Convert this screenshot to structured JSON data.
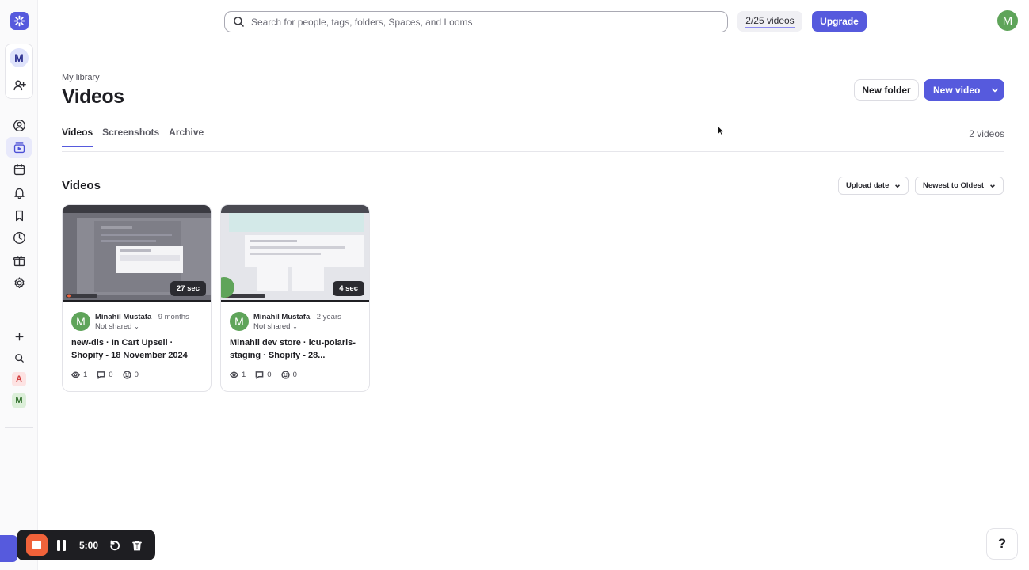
{
  "workspace": {
    "avatar_letter": "M"
  },
  "search": {
    "placeholder": "Search for people, tags, folders, Spaces, and Looms"
  },
  "topbar": {
    "quota": "2/25 videos",
    "upgrade_label": "Upgrade",
    "user_initial": "M"
  },
  "spaces": [
    {
      "letter": "A",
      "bg": "#fde3e3",
      "color": "#d13b3b"
    },
    {
      "letter": "M",
      "bg": "#dcefd9",
      "color": "#2f6e2a"
    }
  ],
  "header": {
    "breadcrumb": "My library",
    "title": "Videos",
    "new_folder_label": "New folder",
    "new_video_label": "New video"
  },
  "tabs": [
    {
      "label": "Videos",
      "active": true
    },
    {
      "label": "Screenshots",
      "active": false
    },
    {
      "label": "Archive",
      "active": false
    }
  ],
  "count_label": "2 videos",
  "section": {
    "title": "Videos",
    "sort_field": "Upload date",
    "sort_order": "Newest to Oldest"
  },
  "videos": [
    {
      "duration": "27 sec",
      "author": "Minahil Mustafa",
      "ago": "9 months",
      "sharing": "Not shared",
      "title": "new-dis · In Cart Upsell · Shopify - 18 November 2024",
      "views": "1",
      "comments": "0",
      "reactions": "0",
      "author_initial": "M"
    },
    {
      "duration": "4 sec",
      "author": "Minahil Mustafa",
      "ago": "2 years",
      "sharing": "Not shared",
      "title": "Minahil dev store · icu-polaris-staging · Shopify - 28...",
      "views": "1",
      "comments": "0",
      "reactions": "0",
      "author_initial": "M"
    }
  ],
  "recorder": {
    "time": "5:00"
  },
  "help_label": "?",
  "colors": {
    "accent": "#565add",
    "avatar_green": "#5fa45a",
    "record_orange": "#f0623a"
  }
}
